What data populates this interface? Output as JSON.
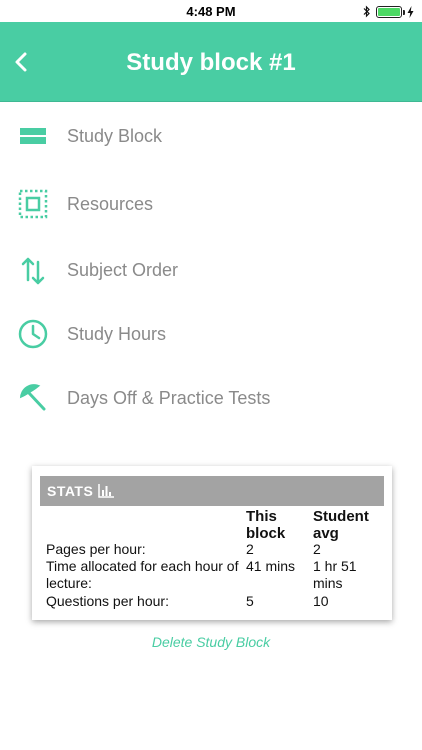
{
  "status_bar": {
    "time": "4:48 PM"
  },
  "nav": {
    "title": "Study block #1"
  },
  "menu": [
    {
      "label": "Study Block",
      "icon": "study-block-icon"
    },
    {
      "label": "Resources",
      "icon": "resources-icon"
    },
    {
      "label": "Subject Order",
      "icon": "sort-arrows-icon"
    },
    {
      "label": "Study Hours",
      "icon": "clock-icon"
    },
    {
      "label": "Days Off & Practice Tests",
      "icon": "umbrella-icon"
    }
  ],
  "stats": {
    "title": "STATS",
    "columns": [
      "",
      "This block",
      "Student avg"
    ],
    "rows": [
      {
        "label": "Pages per hour:",
        "this_block": "2",
        "student_avg": "2"
      },
      {
        "label": "Time allocated for each hour of lecture:",
        "this_block": "41 mins",
        "student_avg": "1 hr 51 mins"
      },
      {
        "label": "Questions per hour:",
        "this_block": "5",
        "student_avg": "10"
      }
    ]
  },
  "delete_label": "Delete Study Block",
  "colors": {
    "accent": "#49cda3",
    "header_gray": "#a3a3a3",
    "menu_text": "#8a8a8a"
  }
}
